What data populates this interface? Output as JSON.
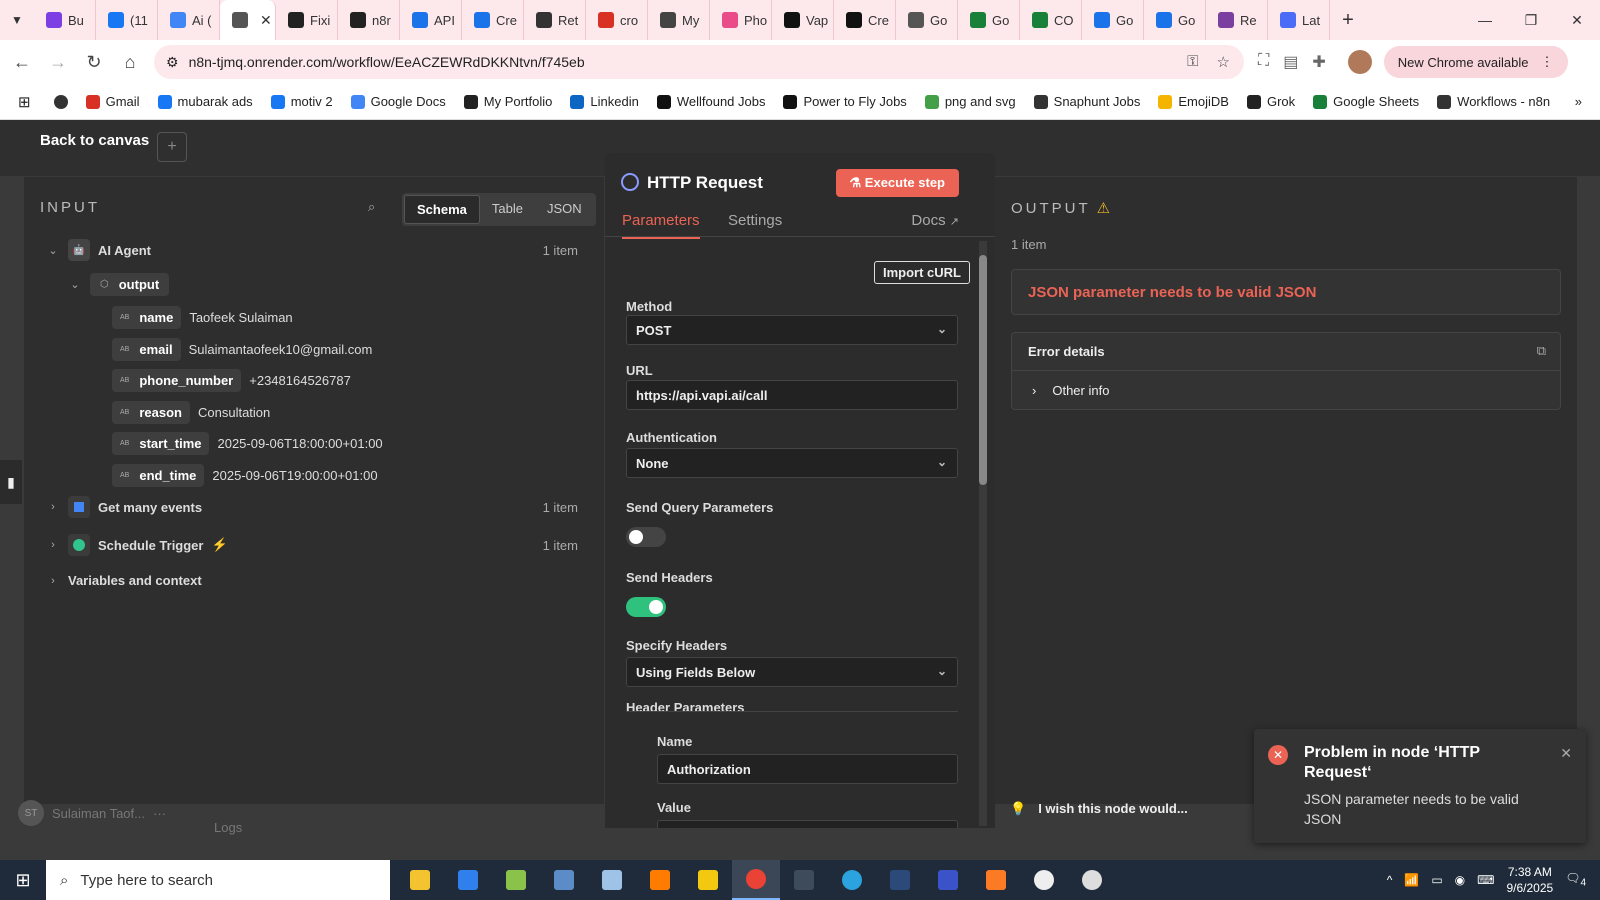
{
  "browser": {
    "tabs": [
      {
        "label": "Bu",
        "icon": "threads-icon",
        "color": "#7b3fe4"
      },
      {
        "label": "(11",
        "icon": "meta-icon",
        "color": "#1877f2"
      },
      {
        "label": "Ai (",
        "icon": "docs-icon",
        "color": "#4285f4"
      },
      {
        "label": "",
        "icon": "globe-icon",
        "color": "#555555",
        "active": true
      },
      {
        "label": "Fixi",
        "icon": "openai-icon",
        "color": "#222222"
      },
      {
        "label": "n8r",
        "icon": "n8n-icon",
        "color": "#222222"
      },
      {
        "label": "API",
        "icon": "api-icon",
        "color": "#1a73e8"
      },
      {
        "label": "Cre",
        "icon": "pin-icon",
        "color": "#1a73e8"
      },
      {
        "label": "Ret",
        "icon": "grid-icon",
        "color": "#333333"
      },
      {
        "label": "cro",
        "icon": "clock-icon",
        "color": "#d93025"
      },
      {
        "label": "My",
        "icon": "loop-icon",
        "color": "#444444"
      },
      {
        "label": "Pho",
        "icon": "dribbble-icon",
        "color": "#ea4c89"
      },
      {
        "label": "Vap",
        "icon": "vapi-icon",
        "color": "#111111"
      },
      {
        "label": "Cre",
        "icon": "vapi-icon",
        "color": "#111111"
      },
      {
        "label": "Go",
        "icon": "globe-icon",
        "color": "#555555"
      },
      {
        "label": "Go",
        "icon": "sheets-icon",
        "color": "#188038"
      },
      {
        "label": "CO",
        "icon": "sheets-icon",
        "color": "#188038"
      },
      {
        "label": "Go",
        "icon": "calendar-icon",
        "color": "#1a73e8"
      },
      {
        "label": "Go",
        "icon": "calendar-icon",
        "color": "#1a73e8"
      },
      {
        "label": "Re",
        "icon": "r-icon",
        "color": "#7b3fa0"
      },
      {
        "label": "Lat",
        "icon": "chart-icon",
        "color": "#4a6cf7"
      }
    ],
    "url": "n8n-tjmq.onrender.com/workflow/EeACZEWRdDKKNtvn/f745eb",
    "new_chrome": "New Chrome available",
    "bookmarks": [
      {
        "label": "Gmail",
        "color": "#d93025"
      },
      {
        "label": "mubarak ads",
        "color": "#1877f2"
      },
      {
        "label": "motiv 2",
        "color": "#1877f2"
      },
      {
        "label": "Google Docs",
        "color": "#4285f4"
      },
      {
        "label": "My Portfolio",
        "color": "#222222"
      },
      {
        "label": "Linkedin",
        "color": "#0a66c2"
      },
      {
        "label": "Wellfound Jobs",
        "color": "#111111"
      },
      {
        "label": "Power to Fly Jobs",
        "color": "#111111"
      },
      {
        "label": "png and svg",
        "color": "#43a047"
      },
      {
        "label": "Snaphunt Jobs",
        "color": "#333333"
      },
      {
        "label": "EmojiDB",
        "color": "#f4b400"
      },
      {
        "label": "Grok",
        "color": "#222222"
      },
      {
        "label": "Google Sheets",
        "color": "#188038"
      },
      {
        "label": "Workflows - n8n",
        "color": "#333333"
      }
    ]
  },
  "app": {
    "back": "Back to canvas",
    "input": {
      "title": "INPUT",
      "views": [
        "Schema",
        "Table",
        "JSON"
      ],
      "node_ai": "AI Agent",
      "node_ai_count": "1 item",
      "output_label": "output",
      "fields": [
        {
          "key": "name",
          "value": "Taofeek Sulaiman"
        },
        {
          "key": "email",
          "value": "Sulaimantaofeek10@gmail.com"
        },
        {
          "key": "phone_number",
          "value": "+2348164526787"
        },
        {
          "key": "reason",
          "value": "Consultation"
        },
        {
          "key": "start_time",
          "value": "2025-09-06T18:00:00+01:00"
        },
        {
          "key": "end_time",
          "value": "2025-09-06T19:00:00+01:00"
        }
      ],
      "node_events": "Get many events",
      "node_events_count": "1 item",
      "node_schedule": "Schedule Trigger",
      "node_schedule_count": "1 item",
      "vars": "Variables and context"
    },
    "node": {
      "title": "HTTP Request",
      "execute": "Execute step",
      "tab_params": "Parameters",
      "tab_settings": "Settings",
      "docs": "Docs",
      "import": "Import cURL",
      "method_label": "Method",
      "method": "POST",
      "url_label": "URL",
      "url": "https://api.vapi.ai/call",
      "auth_label": "Authentication",
      "auth": "None",
      "query_label": "Send Query Parameters",
      "query_on": false,
      "headers_label": "Send Headers",
      "headers_on": true,
      "specify_label": "Specify Headers",
      "specify": "Using Fields Below",
      "header_params": "Header Parameters",
      "name_label": "Name",
      "name_value": "Authorization",
      "value_label": "Value"
    },
    "output": {
      "title": "OUTPUT",
      "count": "1 item",
      "error": "JSON parameter needs to be valid JSON",
      "error_details": "Error details",
      "other_info": "Other info",
      "wish": "I wish this node would..."
    },
    "user": "Sulaiman Taof...",
    "logs": "Logs",
    "toast": {
      "title": "Problem in node ‘HTTP Request‘",
      "message": "JSON parameter needs to be valid JSON"
    }
  },
  "taskbar": {
    "search": "Type here to search",
    "time": "7:38 AM",
    "date": "9/6/2025",
    "notif": "4"
  }
}
